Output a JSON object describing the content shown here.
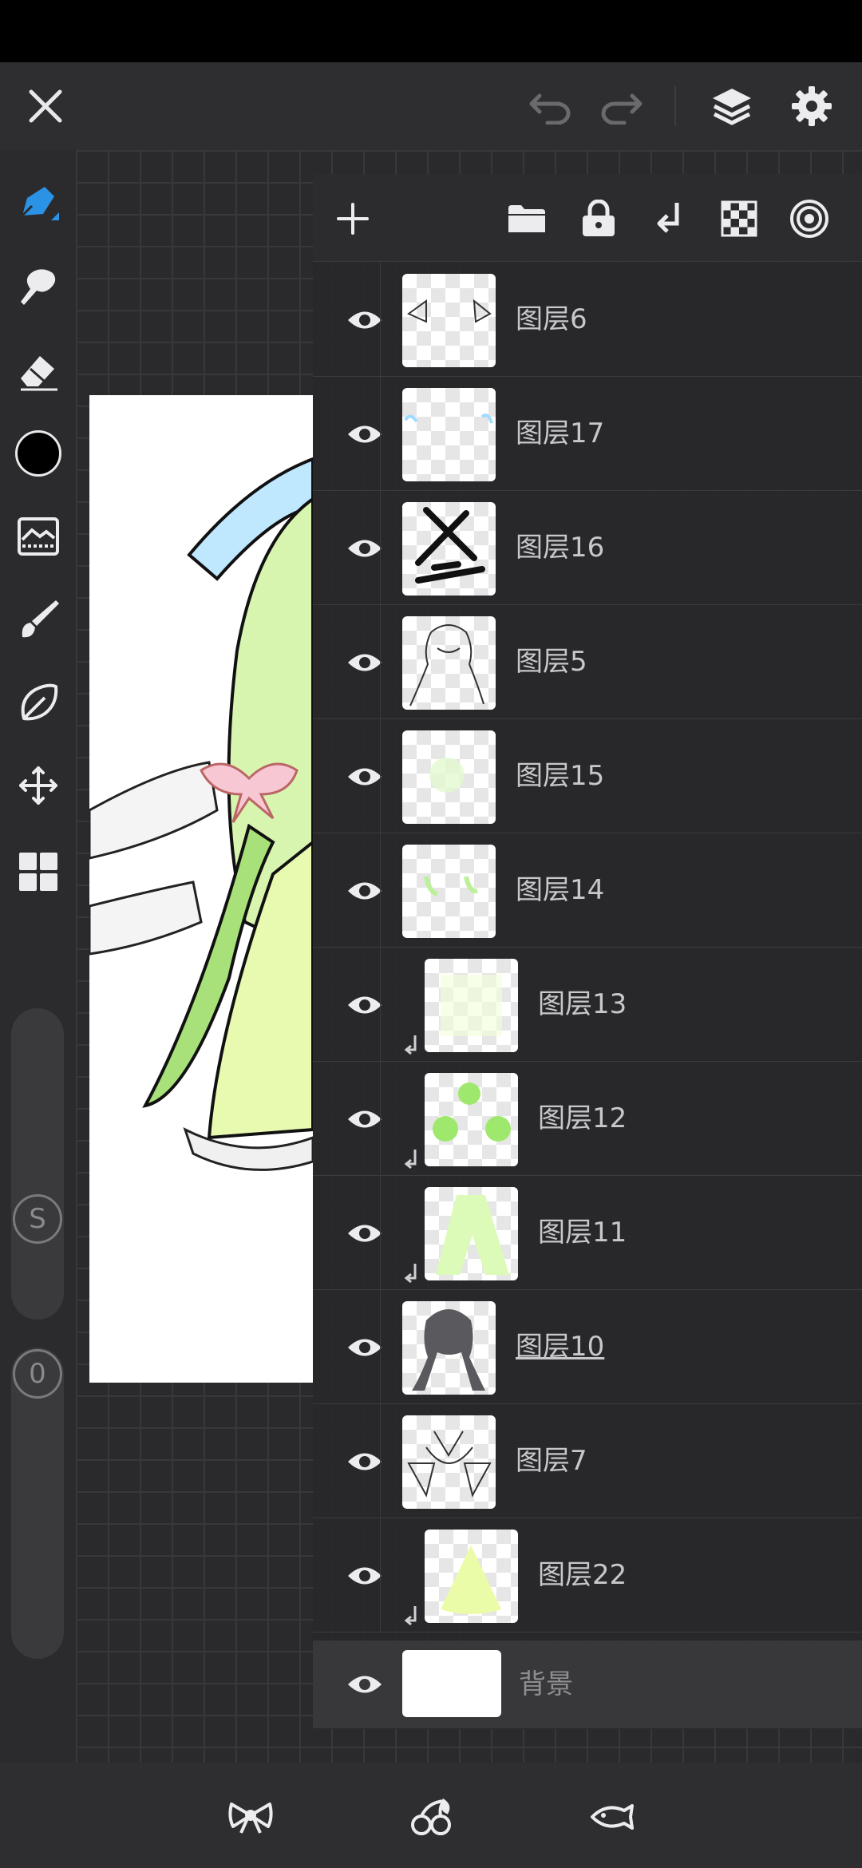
{
  "toolbar": {
    "close_icon": "close-icon",
    "undo_icon": "undo-icon",
    "redo_icon": "redo-icon",
    "layers_icon": "layers-icon",
    "settings_icon": "settings-icon"
  },
  "tools": [
    {
      "name": "pen-tool",
      "active": true
    },
    {
      "name": "smudge-tool"
    },
    {
      "name": "eraser-tool"
    },
    {
      "name": "color-swatch",
      "color": "#000000"
    },
    {
      "name": "image-adjust-tool"
    },
    {
      "name": "brush-tool"
    },
    {
      "name": "lasso-tool"
    },
    {
      "name": "transform-tool"
    },
    {
      "name": "more-tools"
    }
  ],
  "size_slider": {
    "label": "S"
  },
  "opacity_slider": {
    "label": "0"
  },
  "layer_panel": {
    "actions": [
      "add-layer",
      "folder",
      "lock",
      "merge-down",
      "alpha-lock",
      "blend-mode"
    ],
    "layers": [
      {
        "name": "图层6",
        "clipped": false
      },
      {
        "name": "图层17",
        "clipped": false
      },
      {
        "name": "图层16",
        "clipped": false
      },
      {
        "name": "图层5",
        "clipped": false
      },
      {
        "name": "图层15",
        "clipped": false
      },
      {
        "name": "图层14",
        "clipped": false
      },
      {
        "name": "图层13",
        "clipped": true
      },
      {
        "name": "图层12",
        "clipped": true
      },
      {
        "name": "图层11",
        "clipped": true
      },
      {
        "name": "图层10",
        "clipped": false,
        "selected": true
      },
      {
        "name": "图层7",
        "clipped": false
      },
      {
        "name": "图层22",
        "clipped": true
      },
      {
        "name": "背景",
        "clipped": false
      }
    ]
  },
  "bottom": {
    "icons": [
      "bow-icon",
      "cherry-icon",
      "fish-icon"
    ]
  },
  "colors": {
    "accent": "#2a93e6",
    "panel": "#28282b",
    "text": "#c8c8cc"
  }
}
